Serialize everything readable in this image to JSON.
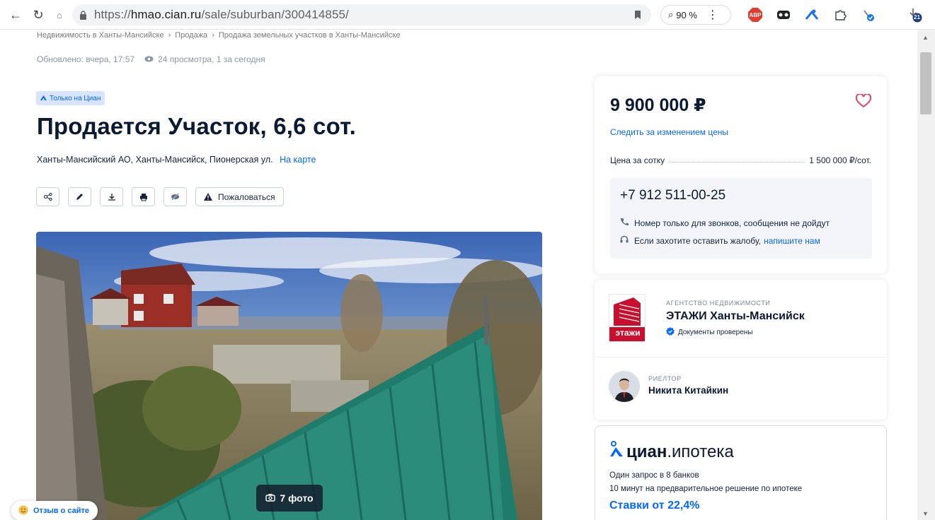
{
  "browser": {
    "back_icon": "←",
    "reload_icon": "↻",
    "url_prefix": "https://",
    "url_domain": "hmao.cian.ru",
    "url_path": "/sale/suburban/300414855/",
    "zoom": "90 %",
    "menu_icon": "⋮",
    "ext_abp": "ABP",
    "badge_count": "21"
  },
  "breadcrumb": {
    "items": [
      "Недвижимость в Ханты-Мансийске",
      "Продажа",
      "Продажа земельных участков в Ханты-Мансийске"
    ],
    "separator": "›"
  },
  "meta": {
    "updated": "Обновлено: вчера, 17:57",
    "views": "24 просмотра, 1 за сегодня"
  },
  "listing": {
    "badge": "Только на Циан",
    "title": "Продается Участок, 6,6 сот.",
    "address": "Ханты-Мансийский АО, Ханты-Мансийск, Пионерская ул.",
    "map_link": "На карте",
    "complain_label": "Пожаловаться",
    "photo_count": "7 фото",
    "feedback_label": "Отзыв о сайте"
  },
  "price_card": {
    "price": "9 900 000 ₽",
    "watch_link": "Следить за изменением цены",
    "per_sotka_label": "Цена за сотку",
    "per_sotka_value": "1 500 000 ₽/сот.",
    "phone": "+7 912 511-00-25",
    "note_calls": "Номер только для звонков, сообщения не дойдут",
    "note_complaint": "Если захотите оставить жалобу,",
    "note_complaint_link": "напишите нам"
  },
  "agency": {
    "type": "АГЕНТСТВО НЕДВИЖИМОСТИ",
    "name": "ЭТАЖИ Ханты-Мансийск",
    "verified": "Документы проверены",
    "logo_text": "этажи",
    "realtor_type": "РИЕЛТОР",
    "realtor_name": "Никита Китайкин"
  },
  "mortgage": {
    "brand": "циан",
    "product": ".ипотека",
    "line1": "Один запрос в 8 банков",
    "line2": "10 минут на предварительное решение по ипотеке",
    "rate": "Ставки от 22,4%"
  },
  "colors": {
    "accent": "#0468ff",
    "heart": "#e84260",
    "agency_red": "#c8102e"
  }
}
